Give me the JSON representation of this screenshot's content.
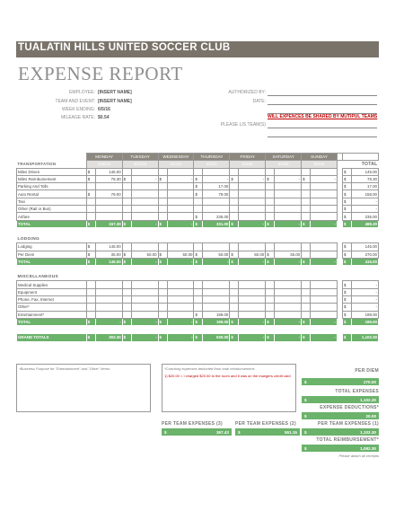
{
  "header": {
    "club": "TUALATIN HILLS UNITED SOCCER CLUB",
    "title": "EXPENSE REPORT",
    "employee_label": "EMPLOYEE:",
    "employee_value": "[INSERT NAME]",
    "team_label": "TEAM AND EVENT:",
    "team_value": "[INSERT NAME]",
    "week_label": "WEEK ENDING:",
    "week_value": "6/5/16",
    "rate_label": "MILEAGE RATE:",
    "rate_value": "$0.54",
    "authorized_label": "AUTHORIZED BY:",
    "date_label": "DATE:",
    "shared_note": "WILL EXPENCES BE SHARED BY MUTIPUL TEAMS",
    "teams_label": "PLEASE LIS TEAM(S)"
  },
  "days": [
    "MONDAY",
    "TUESDAY",
    "WEDNESDAY",
    "THURSDAY",
    "FRIDAY",
    "SATURDAY",
    "SUNDAY"
  ],
  "dates": [
    "5/30/16",
    "5/31/16",
    "6/1/16",
    "6/2/16",
    "6/3/16",
    "6/4/16",
    "6/5/16"
  ],
  "total_label": "TOTAL",
  "transportation": {
    "title": "TRANSPORTATION",
    "rows": [
      [
        "Miles Driven",
        "145.00",
        "",
        "",
        "",
        "",
        "",
        "",
        "145.00"
      ],
      [
        "Miles Reimbursement",
        "78.30",
        "-",
        "-",
        "-",
        "-",
        "-",
        "-",
        "78.30"
      ],
      [
        "Parking And Tolls",
        "",
        "",
        "",
        "17.00",
        "",
        "",
        "",
        "17.00"
      ],
      [
        "Auto Rental",
        "79.00",
        "",
        "",
        "79.00",
        "",
        "",
        "",
        "158.00"
      ],
      [
        "Taxi",
        "",
        "",
        "",
        "",
        "",
        "",
        "",
        "-"
      ],
      [
        "Other (Rail or Bus)",
        "",
        "",
        "",
        "",
        "",
        "",
        "",
        "-"
      ],
      [
        "Airfare",
        "",
        "",
        "",
        "235.00",
        "",
        "",
        "",
        "235.00"
      ]
    ],
    "total": [
      "TOTAL",
      "157.30",
      "-",
      "-",
      "331.00",
      "-",
      "-",
      "-",
      "488.30"
    ]
  },
  "lodging": {
    "title": "LODGING",
    "rows": [
      [
        "Lodging",
        "145.00",
        "",
        "",
        "",
        "",
        "",
        "",
        "145.00"
      ],
      [
        "Per Diem",
        "35.00",
        "50.00",
        "50.00",
        "50.00",
        "50.00",
        "35.00",
        "",
        "270.00"
      ]
    ],
    "total": [
      "TOTAL",
      "145.00",
      "-",
      "-",
      "-",
      "-",
      "-",
      "-",
      "415.00"
    ]
  },
  "misc": {
    "title": "MISCELLANEOUS",
    "rows": [
      [
        "Medical Supplies",
        "",
        "",
        "",
        "",
        "",
        "",
        "",
        "-"
      ],
      [
        "Equipment",
        "",
        "",
        "",
        "",
        "",
        "",
        "",
        "-"
      ],
      [
        "Phone, Fax, Internet",
        "",
        "",
        "",
        "",
        "",
        "",
        "",
        "-"
      ],
      [
        "Other*",
        "",
        "",
        "",
        "",
        "",
        "",
        "",
        "-"
      ],
      [
        "Entertainment*",
        "",
        "",
        "",
        "199.00",
        "",
        "",
        "",
        "199.00"
      ]
    ],
    "total": [
      "TOTAL",
      "-",
      "-",
      "-",
      "199.00",
      "-",
      "-",
      "-",
      "199.00"
    ]
  },
  "grand": [
    "GRAND TOTALS",
    "302.30",
    "-",
    "-",
    "530.00",
    "-",
    "-",
    "-",
    "1,102.30"
  ],
  "currency": "$",
  "notes": {
    "business": "*Business Purpose for \"Entertainment\" and \"Other\" Items:",
    "coaching": "*Coaching expenses deducted from total reimbursement:",
    "coaching_text": "1) $20.00 = I charged $20.00 to the room and it was on the mangers credit card"
  },
  "summary": {
    "per_diem_label": "PER DIEM",
    "per_diem": "270.00",
    "total_exp_label": "TOTAL EXPENSES",
    "total_exp": "1,102.30",
    "deductions_label": "EXPENSE DEDUCTIONS*",
    "deductions": "20.00",
    "team_exp_label": "PER TEAM EXPENSES (3)",
    "team_exp_1": "367.43",
    "team_exp_2": "551.15",
    "team_exp_3": "1,102.30",
    "team_exp_label2": "PER TEAM EXPENSES (2)",
    "team_exp_label3": "PER TEAM EXPENSES (1)",
    "reimb_label": "TOTAL REIMBURSEMENT*",
    "reimb": "1,082.30",
    "attach": "Please attach all receipts"
  }
}
